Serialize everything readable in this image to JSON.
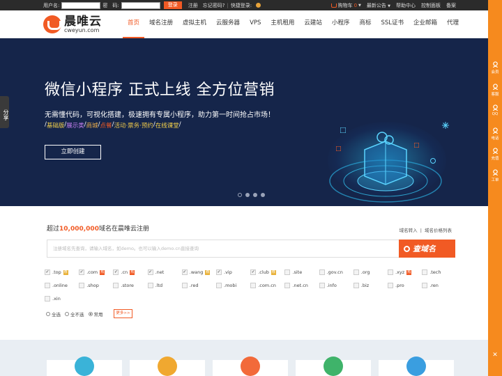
{
  "topbar": {
    "username_label": "用户名:",
    "password_label": "密　码:",
    "login_button": "登录",
    "register": "注册",
    "forgot": "忘记密码?",
    "separator": "|",
    "quick_login": "快捷登录:",
    "cart_label": "购物车",
    "cart_count": "0",
    "announcement": "最新公告",
    "help": "帮助中心",
    "control_panel": "控制面板",
    "beian": "备案"
  },
  "header": {
    "logo_cn": "晨唯云",
    "logo_en": "cweyun.com",
    "nav": [
      "首页",
      "域名注册",
      "虚拟主机",
      "云服务器",
      "VPS",
      "主机租用",
      "云建站",
      "小程序",
      "商标",
      "SSL证书",
      "企业邮箱",
      "代理"
    ],
    "active_index": 0
  },
  "banner": {
    "title": "微信小程序 正式上线 全方位营销",
    "description": "无需懂代码，可视化搭建，极速拥有专属小程序，助力第一时间抢占市场！",
    "features": [
      {
        "text": "/",
        "color": "#ffffff"
      },
      {
        "text": "基础版",
        "color": "#f5d24a"
      },
      {
        "text": "/",
        "color": "#ffffff"
      },
      {
        "text": "展示类",
        "color": "#c680f2"
      },
      {
        "text": "/",
        "color": "#ffffff"
      },
      {
        "text": "商城",
        "color": "#f0b04a"
      },
      {
        "text": "/",
        "color": "#ffffff"
      },
      {
        "text": "点餐",
        "color": "#f15a24"
      },
      {
        "text": "/",
        "color": "#ffffff"
      },
      {
        "text": "活动·票务·预约",
        "color": "#e8c44a"
      },
      {
        "text": "/",
        "color": "#ffffff"
      },
      {
        "text": "在线课堂",
        "color": "#f5d24a"
      },
      {
        "text": "/",
        "color": "#ffffff"
      }
    ],
    "cta": "立即创建",
    "slide_count": 4,
    "active_slide": 0,
    "share_tab": "分享"
  },
  "domain": {
    "intro_prefix": "超过",
    "intro_count": "10,000,000",
    "intro_suffix": "域名在晨唯云注册",
    "link_transfer": "域名转入",
    "link_sep": "|",
    "link_price": "域名价格列表",
    "search_placeholder": "注册域名先查询，请输入域名，如demo。也可以输入demo.cn直接查询",
    "search_button": "查域名",
    "tlds": [
      {
        "name": ".top",
        "checked": true,
        "tag": "rec"
      },
      {
        "name": ".com",
        "checked": true,
        "tag": "hot"
      },
      {
        "name": ".cn",
        "checked": true,
        "tag": "hot"
      },
      {
        "name": ".net",
        "checked": true,
        "tag": ""
      },
      {
        "name": ".wang",
        "checked": true,
        "tag": "rec"
      },
      {
        "name": ".vip",
        "checked": true,
        "tag": ""
      },
      {
        "name": ".club",
        "checked": true,
        "tag": "rec"
      },
      {
        "name": ".site",
        "checked": false,
        "tag": ""
      },
      {
        "name": ".gov.cn",
        "checked": false,
        "tag": ""
      },
      {
        "name": ".org",
        "checked": false,
        "tag": ""
      },
      {
        "name": ".xyz",
        "checked": false,
        "tag": "hot"
      },
      {
        "name": ".tech",
        "checked": false,
        "tag": ""
      },
      {
        "name": ".online",
        "checked": false,
        "tag": ""
      },
      {
        "name": ".shop",
        "checked": false,
        "tag": ""
      },
      {
        "name": ".store",
        "checked": false,
        "tag": ""
      },
      {
        "name": ".ltd",
        "checked": false,
        "tag": ""
      },
      {
        "name": ".red",
        "checked": false,
        "tag": ""
      },
      {
        "name": ".mobi",
        "checked": false,
        "tag": ""
      },
      {
        "name": ".com.cn",
        "checked": false,
        "tag": ""
      },
      {
        "name": ".net.cn",
        "checked": false,
        "tag": ""
      },
      {
        "name": ".info",
        "checked": false,
        "tag": ""
      },
      {
        "name": ".biz",
        "checked": false,
        "tag": ""
      },
      {
        "name": ".pro",
        "checked": false,
        "tag": ""
      },
      {
        "name": ".ren",
        "checked": false,
        "tag": ""
      },
      {
        "name": ".xin",
        "checked": false,
        "tag": ""
      }
    ],
    "tag_labels": {
      "hot": "热",
      "rec": "荐"
    },
    "radio_all": "全选",
    "radio_none": "全不选",
    "radio_common": "常用",
    "selected_radio": "常用",
    "more_button": "更多>>"
  },
  "products": {
    "icons": [
      {
        "name": "website-builder-icon",
        "color": "#3ab3d8"
      },
      {
        "name": "server-icon",
        "color": "#f0a830"
      },
      {
        "name": "cloud-host-icon",
        "color": "#f26a3a"
      },
      {
        "name": "datacenter-icon",
        "color": "#3fb36a"
      },
      {
        "name": "domain-globe-icon",
        "color": "#3a9ee0"
      }
    ]
  },
  "sidebar": {
    "items": [
      {
        "label": "会员",
        "icon": "member-icon"
      },
      {
        "label": "客服",
        "icon": "headset-icon"
      },
      {
        "label": "QQ",
        "icon": "qq-icon"
      },
      {
        "label": "电话",
        "icon": "phone-icon"
      },
      {
        "label": "充值",
        "icon": "recharge-icon"
      },
      {
        "label": "工单",
        "icon": "ticket-icon"
      }
    ],
    "close_glyph": "✕"
  },
  "colors": {
    "brand": "#f15a24",
    "banner_bg": "#15254a",
    "sidebar": "#f68a1e",
    "topbar": "#2b2b2b"
  }
}
